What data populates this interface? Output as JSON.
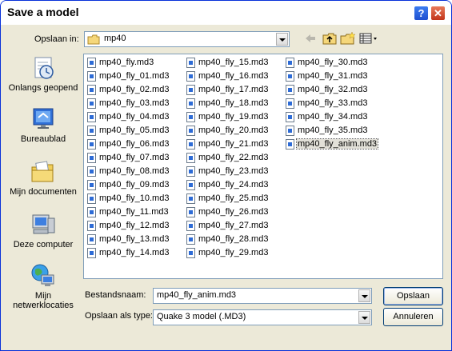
{
  "window": {
    "title": "Save a model"
  },
  "titlebar": {
    "help_label": "?",
    "close_label": "✕"
  },
  "lookin": {
    "label": "Opslaan in:",
    "value": "mp40"
  },
  "toolbar": {
    "icons": [
      "back-arrow-icon",
      "up-folder-icon",
      "new-folder-icon",
      "view-menu-icon"
    ]
  },
  "places": [
    {
      "label": "Onlangs geopend",
      "icon": "recent-documents-icon"
    },
    {
      "label": "Bureaublad",
      "icon": "desktop-icon"
    },
    {
      "label": "Mijn documenten",
      "icon": "my-documents-icon"
    },
    {
      "label": "Deze computer",
      "icon": "my-computer-icon"
    },
    {
      "label": "Mijn netwerklocaties",
      "icon": "network-places-icon"
    }
  ],
  "files": {
    "col1": [
      "mp40_fly.md3",
      "mp40_fly_01.md3",
      "mp40_fly_02.md3",
      "mp40_fly_03.md3",
      "mp40_fly_04.md3",
      "mp40_fly_05.md3",
      "mp40_fly_06.md3",
      "mp40_fly_07.md3",
      "mp40_fly_08.md3",
      "mp40_fly_09.md3",
      "mp40_fly_10.md3",
      "mp40_fly_11.md3",
      "mp40_fly_12.md3",
      "mp40_fly_13.md3",
      "mp40_fly_14.md3"
    ],
    "col2": [
      "mp40_fly_15.md3",
      "mp40_fly_16.md3",
      "mp40_fly_17.md3",
      "mp40_fly_18.md3",
      "mp40_fly_19.md3",
      "mp40_fly_20.md3",
      "mp40_fly_21.md3",
      "mp40_fly_22.md3",
      "mp40_fly_23.md3",
      "mp40_fly_24.md3",
      "mp40_fly_25.md3",
      "mp40_fly_26.md3",
      "mp40_fly_27.md3",
      "mp40_fly_28.md3",
      "mp40_fly_29.md3"
    ],
    "col3": [
      "mp40_fly_30.md3",
      "mp40_fly_31.md3",
      "mp40_fly_32.md3",
      "mp40_fly_33.md3",
      "mp40_fly_34.md3",
      "mp40_fly_35.md3",
      "mp40_fly_anim.md3"
    ],
    "selected": "mp40_fly_anim.md3"
  },
  "filename": {
    "label": "Bestandsnaam:",
    "value": "mp40_fly_anim.md3"
  },
  "filetype": {
    "label": "Opslaan als type:",
    "value": "Quake 3 model (.MD3)"
  },
  "buttons": {
    "save": "Opslaan",
    "cancel": "Annuleren"
  }
}
